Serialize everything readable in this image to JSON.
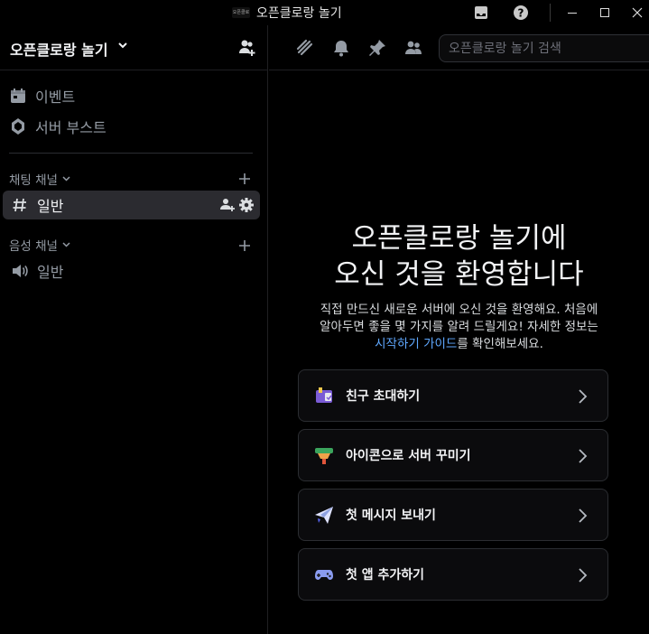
{
  "window": {
    "title": "오픈클로랑 놀기",
    "app_icon_text": "오픈클로"
  },
  "sidebar": {
    "server_name": "오픈클로랑 놀기",
    "items": [
      {
        "label": "이벤트",
        "icon": "calendar-icon"
      },
      {
        "label": "서버 부스트",
        "icon": "boost-gem-icon"
      }
    ],
    "categories": [
      {
        "label": "채팅 채널",
        "channels": [
          {
            "label": "일반",
            "icon": "hash-icon",
            "active": true
          }
        ]
      },
      {
        "label": "음성 채널",
        "channels": [
          {
            "label": "일반",
            "icon": "speaker-icon",
            "active": false
          }
        ]
      }
    ]
  },
  "toolbar": {
    "search_placeholder": "오픈클로랑 놀기 검색"
  },
  "welcome": {
    "title_line1": "오픈클로랑 놀기에",
    "title_line2": "오신 것을 환영합니다",
    "desc_line1": "직접 만드신 새로운 서버에 오신 것을 환영해요. 처음에",
    "desc_line2": "알아두면 좋을 몇 가지를 알려   드릴게요! 자세한 정보는",
    "desc_link": "시작하기 가이드",
    "desc_tail": "를 확인해보세요.",
    "cards": [
      {
        "label": "친구 초대하기",
        "icon": "invite-friends-icon"
      },
      {
        "label": "아이콘으로 서버 꾸미기",
        "icon": "server-icon-paint-icon"
      },
      {
        "label": "첫 메시지 보내기",
        "icon": "paper-plane-icon"
      },
      {
        "label": "첫 앱 추가하기",
        "icon": "gamepad-icon"
      }
    ]
  },
  "colors": {
    "background": "#000000",
    "text_muted": "#949ba4",
    "text_bright": "#f2f3f5",
    "link": "#5fa8ff",
    "active_channel_bg": "#2b2b30"
  }
}
